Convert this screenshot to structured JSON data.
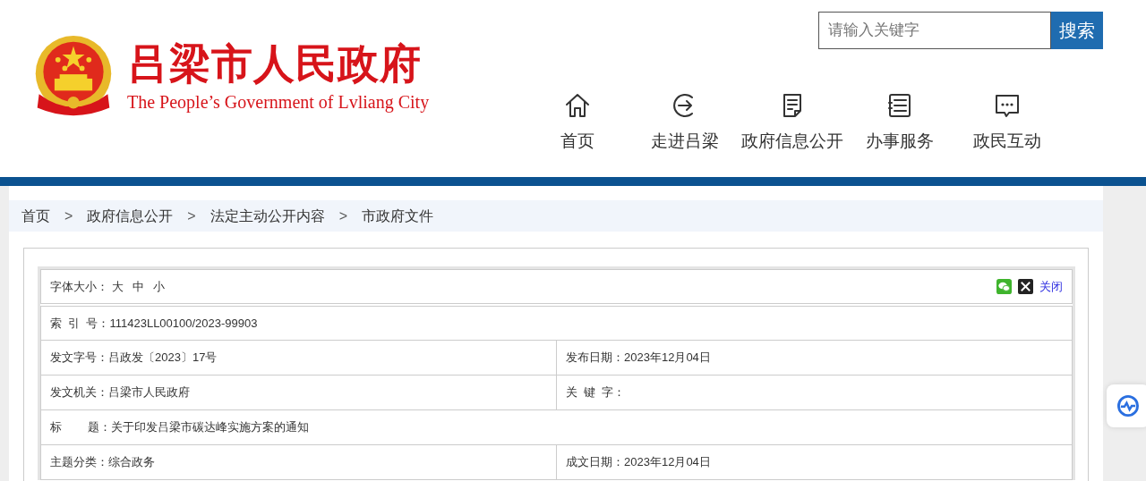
{
  "site": {
    "title": "吕梁市人民政府",
    "subtitle": "The People’s Government of Lvliang City"
  },
  "search": {
    "placeholder": "请输入关键字",
    "button": "搜索"
  },
  "nav": [
    {
      "label": "首页",
      "kind": "home"
    },
    {
      "label": "走进吕梁",
      "kind": "enter"
    },
    {
      "label": "政府信息公开",
      "kind": "document"
    },
    {
      "label": "办事服务",
      "kind": "list"
    },
    {
      "label": "政民互动",
      "kind": "chat"
    }
  ],
  "breadcrumb": [
    "首页",
    "政府信息公开",
    "法定主动公开内容",
    "市政府文件"
  ],
  "breadcrumb_separator": ">",
  "font_size": {
    "label": "字体大小：",
    "options": [
      "大",
      "中",
      "小"
    ]
  },
  "close_link": "关闭",
  "info_rows": [
    [
      {
        "label": "索  引  号：",
        "value": "111423LL00100/2023-99903"
      }
    ],
    [
      {
        "label": "发文字号：",
        "value": "吕政发〔2023〕17号"
      },
      {
        "label": "发布日期：",
        "value": "2023年12月04日"
      }
    ],
    [
      {
        "label": "发文机关：",
        "value": "吕梁市人民政府"
      },
      {
        "label": "关  键  字："
      }
    ],
    [
      {
        "label": "标        题：",
        "value": "关于印发吕梁市碳达峰实施方案的通知"
      }
    ],
    [
      {
        "label": "主题分类：",
        "value": "综合政务"
      },
      {
        "label": "成文日期：",
        "value": "2023年12月04日"
      }
    ]
  ]
}
